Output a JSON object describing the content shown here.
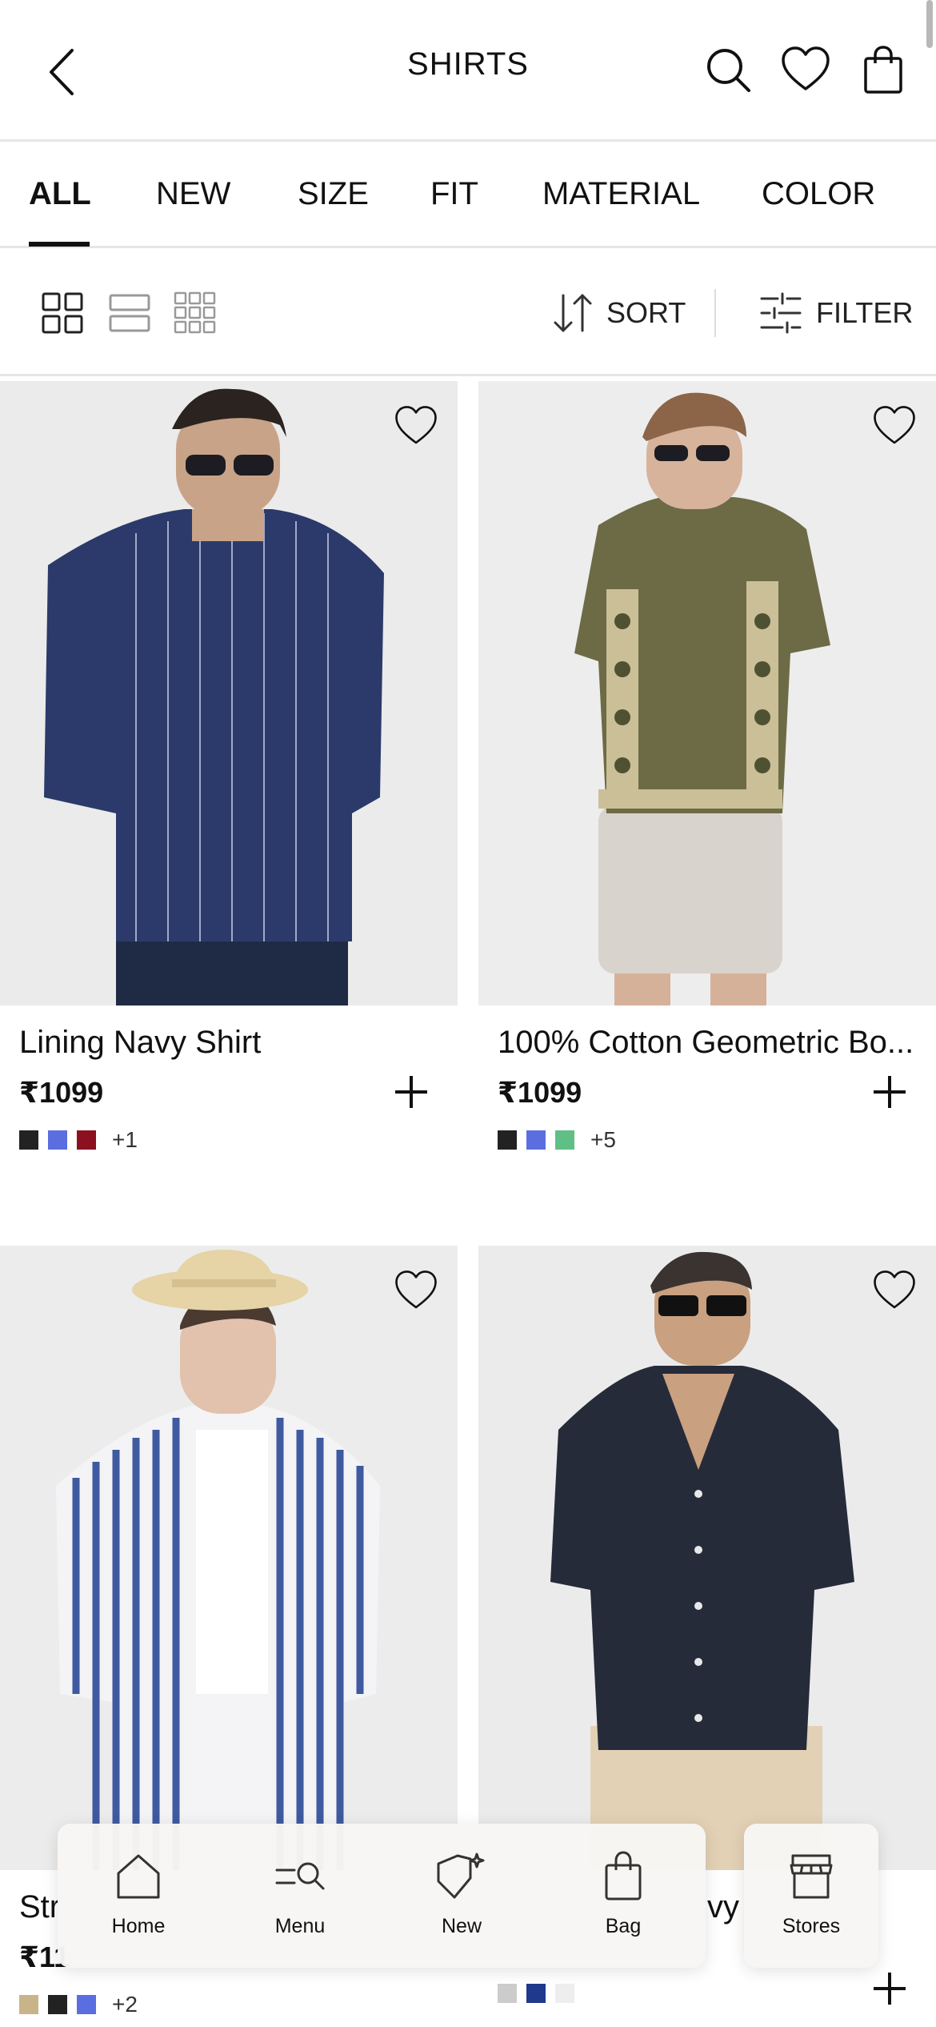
{
  "header": {
    "title": "SHIRTS"
  },
  "tabs": [
    {
      "label": "ALL",
      "active": true
    },
    {
      "label": "NEW"
    },
    {
      "label": "SIZE"
    },
    {
      "label": "FIT"
    },
    {
      "label": "MATERIAL"
    },
    {
      "label": "COLOR"
    }
  ],
  "toolbar": {
    "sort_label": "SORT",
    "filter_label": "FILTER"
  },
  "products": [
    {
      "name": "Lining Navy Shirt",
      "price": "₹1099",
      "swatches": [
        "#222222",
        "#5b6ee0",
        "#8c1020"
      ],
      "more": "+1"
    },
    {
      "name": "100% Cotton Geometric Bo...",
      "price": "₹1099",
      "swatches": [
        "#222222",
        "#5b6ee0",
        "#5fbf85"
      ],
      "more": "+5"
    },
    {
      "name": "Str",
      "price": "₹11",
      "swatches": [
        "#c9b48a",
        "#222222",
        "#5b6ee0"
      ],
      "more": "+2"
    },
    {
      "name": "vy",
      "price": "",
      "swatches": [
        "#cccccc",
        "#1f3a8a",
        "#eeeeee"
      ],
      "more": ""
    }
  ],
  "bottom_nav": [
    {
      "label": "Home",
      "icon": "home-icon"
    },
    {
      "label": "Menu",
      "icon": "menu-search-icon"
    },
    {
      "label": "New",
      "icon": "new-tag-icon"
    },
    {
      "label": "Bag",
      "icon": "bag-icon"
    }
  ],
  "stores": {
    "label": "Stores",
    "icon": "store-icon"
  }
}
